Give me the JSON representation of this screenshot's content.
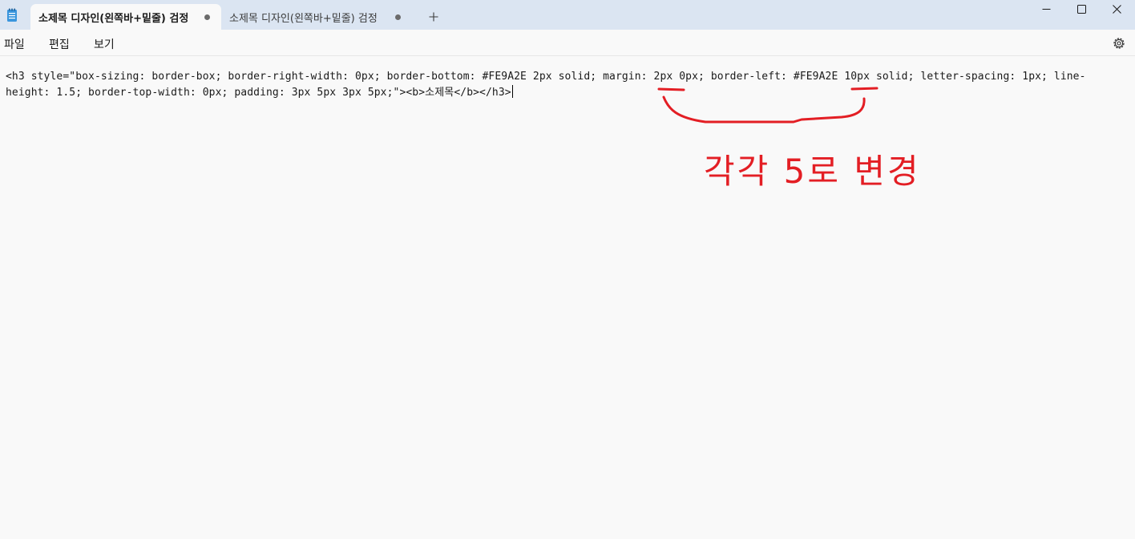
{
  "tabs": [
    {
      "label": "소제목 디자인(왼쪽바+밑줄) 검정",
      "active": true
    },
    {
      "label": "소제목 디자인(왼쪽바+밑줄) 검정",
      "active": false
    }
  ],
  "window_controls": {
    "minimize_icon": "minimize-icon",
    "maximize_icon": "maximize-icon",
    "close_icon": "close-icon"
  },
  "menu": {
    "file": "파일",
    "edit": "편집",
    "view": "보기"
  },
  "editor": {
    "line1": "<h3 style=\"box-sizing: border-box; border-right-width: 0px; border-bottom: #FE9A2E 2px solid; margin: 2px 0px; border-left: #FE9A2E 10px solid; letter-spacing: 1px; line-height: 1.5; border-top-width: 0px; padding: 3px 5px 3px 5px;\"><b>소제목</b></h3>"
  },
  "annotation": {
    "text": "각각 5로 변경",
    "color": "#e31e24"
  },
  "colors": {
    "titlebar": "#dbe5f2",
    "background": "#f9f9f9",
    "accent_icon": "#2b88d8"
  }
}
